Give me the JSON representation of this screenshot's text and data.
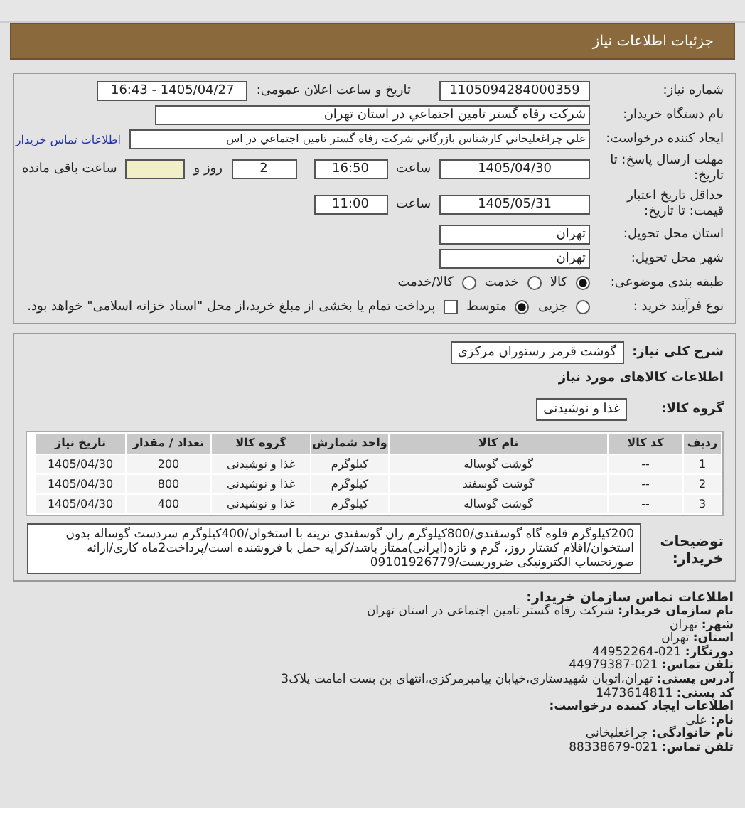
{
  "header": {
    "title": "جزئیات اطلاعات نیاز"
  },
  "need": {
    "number": {
      "label": "شماره نیاز:",
      "value": "1105094284000359"
    },
    "announce": {
      "label": "تاریخ و ساعت اعلان عمومی:",
      "value": "1405/04/27 - 16:43"
    },
    "buyer": {
      "label": "نام دستگاه خریدار:",
      "value": "شركت رفاه گستر تامين اجتماعي در استان تهران"
    },
    "creator": {
      "label": "ایجاد کننده درخواست:",
      "value": "علي چراغعليخاني كارشناس بازرگاني شركت رفاه گستر تامين اجتماعي در اس",
      "link": "اطلاعات تماس خریدار"
    },
    "deadline": {
      "label": "مهلت ارسال پاسخ: تا تاریخ:",
      "date": "1405/04/30",
      "time_label": "ساعت",
      "time": "16:50",
      "days": "2",
      "days_label": "روز و",
      "remaining_label": "ساعت باقی مانده"
    },
    "validity": {
      "label": "حداقل تاریخ اعتبار قیمت: تا تاریخ:",
      "date": "1405/05/31",
      "time_label": "ساعت",
      "time": "11:00"
    },
    "province": {
      "label": "استان محل تحویل:",
      "value": "تهران"
    },
    "city": {
      "label": "شهر محل تحویل:",
      "value": "تهران"
    },
    "category": {
      "label": "طبقه بندی موضوعی:",
      "options": [
        {
          "label": "کالا",
          "selected": true
        },
        {
          "label": "خدمت",
          "selected": false
        },
        {
          "label": "کالا/خدمت",
          "selected": false
        }
      ]
    },
    "process": {
      "label": "نوع فرآیند خرید :",
      "options": [
        {
          "label": "جزیی",
          "selected": false
        },
        {
          "label": "متوسط",
          "selected": true
        }
      ],
      "treasury": {
        "label": "پرداخت تمام یا بخشی از مبلغ خرید،از محل \"اسناد خزانه اسلامی\" خواهد بود.",
        "checked": false
      }
    }
  },
  "goods": {
    "summary_label": "شرح کلی نیاز:",
    "summary": "گوشت قرمز رستوران مرکزی",
    "section_title": "اطلاعات کالاهای مورد نیاز",
    "group_label": "گروه کالا:",
    "group": "غذا و نوشیدنی",
    "columns": [
      "ردیف",
      "کد کالا",
      "نام کالا",
      "واحد شمارش",
      "گروه کالا",
      "تعداد / مقدار",
      "تاریخ نیاز"
    ],
    "rows": [
      [
        "1",
        "--",
        "گوشت گوساله",
        "کیلوگرم",
        "غذا و نوشیدنی",
        "200",
        "1405/04/30"
      ],
      [
        "2",
        "--",
        "گوشت گوسفند",
        "کیلوگرم",
        "غذا و نوشیدنی",
        "800",
        "1405/04/30"
      ],
      [
        "3",
        "--",
        "گوشت گوساله",
        "کیلوگرم",
        "غذا و نوشیدنی",
        "400",
        "1405/04/30"
      ]
    ],
    "notes_label": "توضیحات خریدار:",
    "notes": "200کیلوگرم قلوه گاه گوسفندی/800کیلوگرم ران گوسفندی نرینه با استخوان/400کیلوگرم سردست گوساله بدون استخوان/اقلام کشتار روز، گرم و تازه(ایرانی)ممتاز باشد/کرایه حمل با فروشنده است/پرداخت2ماه کاری/ارائه صورتحساب الکترونیکی ضروریست/09101926779"
  },
  "contact": {
    "title": "اطلاعات تماس سازمان خریدار:",
    "items": [
      {
        "kind": "line",
        "label": "نام سازمان خریدار:",
        "value": "شرکت رفاه گستر تامین اجتماعی در استان تهران"
      },
      {
        "kind": "line",
        "label": "شهر:",
        "value": "تهران"
      },
      {
        "kind": "line",
        "label": "استان:",
        "value": "تهران"
      },
      {
        "kind": "line",
        "label": "دورنگار:",
        "value": "021-44952264"
      },
      {
        "kind": "line",
        "label": "تلفن تماس:",
        "value": "021-44979387"
      },
      {
        "kind": "line",
        "label": "آدرس پستی:",
        "value": "تهران،اتوبان شهیدستاری،خیابان پیامبرمرکزی،انتهای بن بست امامت پلاک3"
      },
      {
        "kind": "line",
        "label": "کد پستی:",
        "value": "1473614811"
      },
      {
        "kind": "heading",
        "label": "اطلاعات ایجاد کننده درخواست:"
      },
      {
        "kind": "line",
        "label": "نام:",
        "value": "علی"
      },
      {
        "kind": "line",
        "label": "نام خانوادگی:",
        "value": "چراغعلیخانی"
      },
      {
        "kind": "line",
        "label": "تلفن تماس:",
        "value": "021-88338679"
      }
    ]
  }
}
